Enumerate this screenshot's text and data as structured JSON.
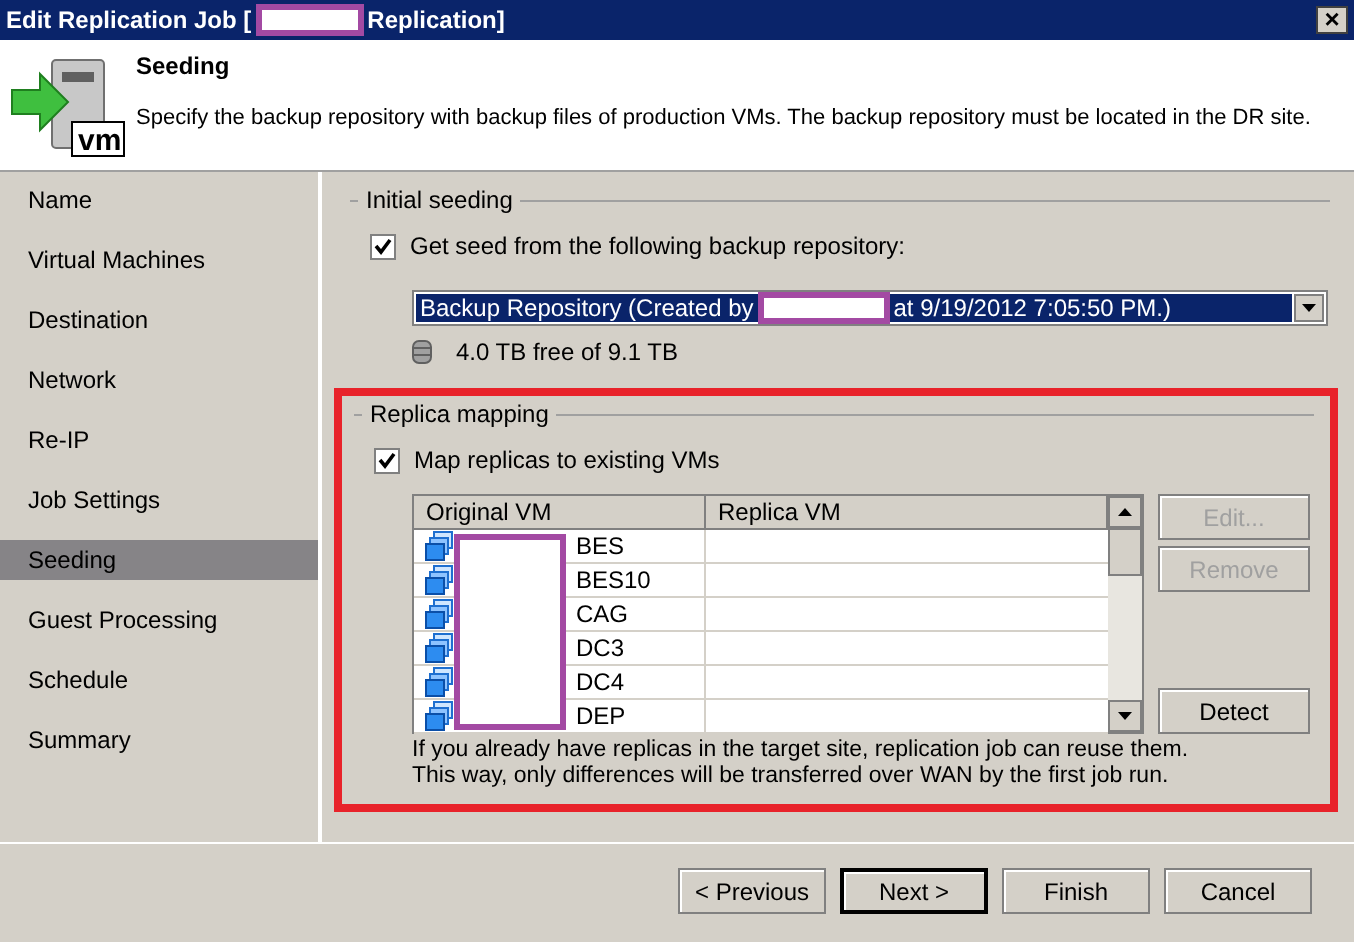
{
  "window": {
    "title_start": "Edit Replication Job [",
    "title_end": "Replication]",
    "close": "×"
  },
  "header": {
    "icon_label": "vm",
    "title": "Seeding",
    "description": "Specify the backup repository with backup files of production VMs. The backup repository must be located in the DR site."
  },
  "sidebar": {
    "items": [
      {
        "label": "Name",
        "selected": false
      },
      {
        "label": "Virtual Machines",
        "selected": false
      },
      {
        "label": "Destination",
        "selected": false
      },
      {
        "label": "Network",
        "selected": false
      },
      {
        "label": "Re-IP",
        "selected": false
      },
      {
        "label": "Job Settings",
        "selected": false
      },
      {
        "label": "Seeding",
        "selected": true
      },
      {
        "label": "Guest Processing",
        "selected": false
      },
      {
        "label": "Schedule",
        "selected": false
      },
      {
        "label": "Summary",
        "selected": false
      }
    ]
  },
  "initial_seeding": {
    "legend": "Initial seeding",
    "checkbox": {
      "label": "Get seed from the following backup repository:",
      "checked": true
    },
    "repository": {
      "value_start": "Backup Repository (Created by",
      "value_end": "at 9/19/2012 7:05:50 PM.)",
      "selected": true
    },
    "free_space": "4.0 TB free of 9.1 TB"
  },
  "replica_mapping": {
    "legend": "Replica mapping",
    "checkbox": {
      "label": "Map replicas to existing VMs",
      "checked": true
    },
    "table": {
      "columns": [
        "Original VM",
        "Replica VM"
      ],
      "rows": [
        {
          "original": "BES"
        },
        {
          "original": "BES10"
        },
        {
          "original": "CAG"
        },
        {
          "original": "DC3"
        },
        {
          "original": "DC4"
        },
        {
          "original": "DEP"
        }
      ]
    },
    "buttons": [
      {
        "label": "Edit...",
        "disabled": true
      },
      {
        "label": "Remove",
        "disabled": true
      },
      {
        "label": "Detect",
        "disabled": false
      }
    ],
    "note": "If you already have replicas in the target site, replication job can reuse them. This way, only differences will be transferred over WAN by the first job run."
  },
  "footer": {
    "buttons": [
      {
        "label": "< Previous",
        "default": false
      },
      {
        "label": "Next >",
        "default": true
      },
      {
        "label": "Finish",
        "default": false
      },
      {
        "label": "Cancel",
        "default": false
      }
    ]
  }
}
